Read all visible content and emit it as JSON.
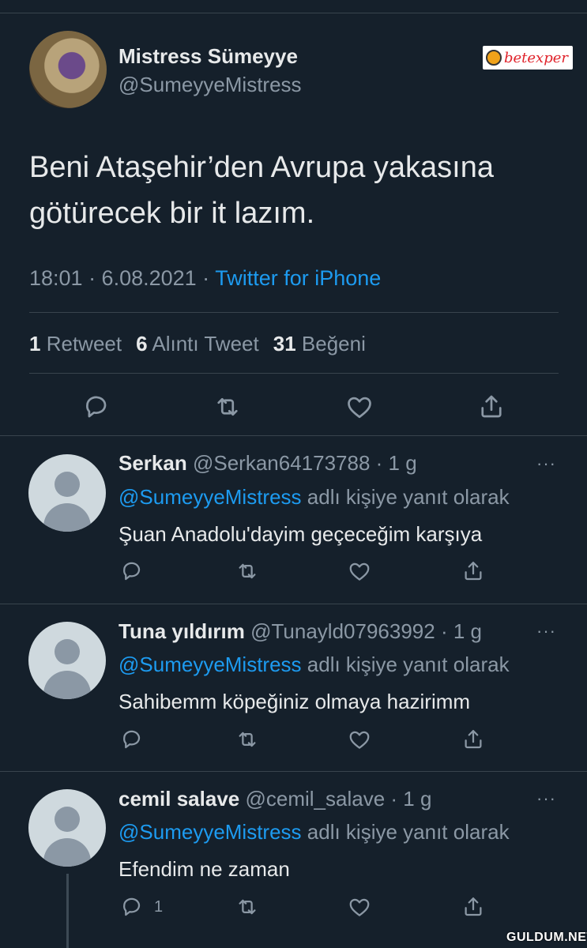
{
  "tweet": {
    "author_name": "Mistress Sümeyye",
    "author_handle": "@SumeyyeMistress",
    "text": "Beni Ataşehir’den Avrupa yakasına\ngötürecek bir it lazım.",
    "time": "18:01 · 6.08.2021 · ",
    "source": "Twitter for iPhone",
    "stats": {
      "retweets": "1",
      "retweets_label": "Retweet",
      "quotes": "6",
      "quotes_label": "Alıntı Tweet",
      "likes": "31",
      "likes_label": "Beğeni"
    }
  },
  "ad_badge": {
    "brand": "betexper"
  },
  "replies": [
    {
      "name": "Serkan",
      "handle": "@Serkan64173788 · 1 g",
      "replying_mention": "@SumeyyeMistress",
      "replying_suffix": " adlı kişiye yanıt olarak",
      "text": "Şuan Anadolu'dayim geçeceğim karşıya",
      "more": "···"
    },
    {
      "name": "Tuna yıldırım",
      "handle": "@Tunayld07963992 · 1 g",
      "replying_mention": "@SumeyyeMistress",
      "replying_suffix": " adlı kişiye yanıt olarak",
      "text": "Sahibemm köpeğiniz olmaya hazirimm",
      "more": "···"
    },
    {
      "name": "cemil salave",
      "handle": "@cemil_salave · 1 g",
      "replying_mention": "@SumeyyeMistress",
      "replying_suffix": " adlı kişiye yanıt olarak",
      "text": "Efendim ne zaman",
      "more": "···",
      "reply_count": "1"
    }
  ],
  "watermark": "GULDUM.NET",
  "icons": [
    "reply-icon",
    "retweet-icon",
    "like-icon",
    "share-icon"
  ],
  "colors": {
    "background": "#15202b",
    "accent": "#1d9bf0",
    "secondary_text": "#8b98a5",
    "divider": "#38444d"
  }
}
